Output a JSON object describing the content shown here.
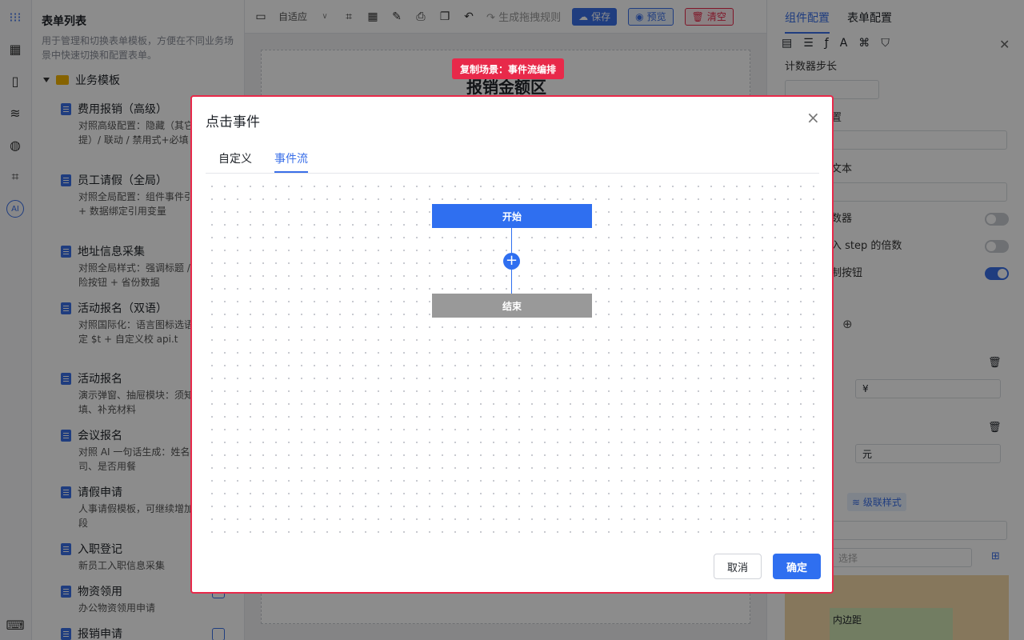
{
  "left_panel": {
    "title": "表单列表",
    "desc": "用于管理和切换表单模板，方便在不同业务场景中快速切换和配置表单。",
    "group": "业务模板",
    "templates": [
      {
        "name": "费用报销（高级）",
        "desc": "对照高级配置：隐藏（其它明/快速自提）/ 联动 / 禁用式+必填"
      },
      {
        "name": "员工请假（全局）",
        "desc": "对照全局配置：组件事件引全局事件 + 数据绑定引用变量"
      },
      {
        "name": "地址信息采集",
        "desc": "对照全局样式：强调标题 / 按钮 / 危险按钮 + 省份数据"
      },
      {
        "name": "活动报名（双语）",
        "desc": "对照国际化：语言图标选语 + 数据绑定 $t + 自定义校 api.t"
      },
      {
        "name": "活动报名",
        "desc": "演示弹窗、抽屉模块：须知选品回填、补充材料"
      },
      {
        "name": "会议报名",
        "desc": "对照 AI 一句话生成：姓名机号、公司、是否用餐"
      },
      {
        "name": "请假申请",
        "desc": "人事请假模板，可继续增加理人等字段"
      },
      {
        "name": "入职登记",
        "desc": "新员工入职信息采集"
      },
      {
        "name": "物资领用",
        "desc": "办公物资领用申请"
      },
      {
        "name": "报销申请",
        "desc": ""
      }
    ]
  },
  "toolbar": {
    "adapt_label": "自适应",
    "generate_rule": "生成拖拽规则",
    "save": "保存",
    "preview": "预览",
    "clear": "清空"
  },
  "canvas": {
    "title": "报销金额区",
    "copy_tag": "复制场景：事件流编排"
  },
  "right_panel": {
    "tabs": [
      "组件配置",
      "表单配置"
    ],
    "step_label": "计数器步长",
    "f1": "置",
    "f2": "文本",
    "f3": "数器",
    "f4": "入 step 的倍数",
    "f5": "制按钮",
    "prefix_value": "¥",
    "suffix_value": "元",
    "cascade_style": "级联样式",
    "select_placeholder": "选择",
    "inner_padding": "内边距"
  },
  "modal": {
    "title": "点击事件",
    "tabs": [
      "自定义",
      "事件流"
    ],
    "active_tab": 1,
    "start_node": "开始",
    "end_node": "结束",
    "cancel": "取消",
    "confirm": "确定"
  }
}
